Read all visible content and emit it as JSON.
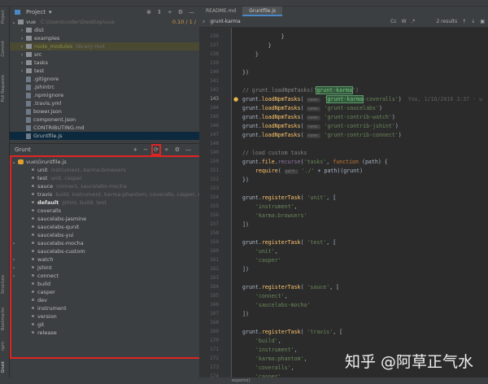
{
  "project": {
    "title": "Project",
    "root": "vue",
    "root_path": "C:\\Users\\coder\\Desktop\\vue",
    "version": "0.10 / 1 /",
    "items": [
      {
        "label": "dist",
        "type": "folder"
      },
      {
        "label": "examples",
        "type": "folder"
      },
      {
        "label": "node_modules",
        "hint": "library root",
        "type": "folder",
        "ignored": true
      },
      {
        "label": "src",
        "type": "folder"
      },
      {
        "label": "tasks",
        "type": "folder"
      },
      {
        "label": "test",
        "type": "folder"
      },
      {
        "label": ".gitignore",
        "type": "file"
      },
      {
        "label": ".jshintrc",
        "type": "file"
      },
      {
        "label": ".npmignore",
        "type": "file"
      },
      {
        "label": ".travis.yml",
        "type": "file"
      },
      {
        "label": "bower.json",
        "type": "file"
      },
      {
        "label": "component.json",
        "type": "file"
      },
      {
        "label": "CONTRIBUTING.md",
        "type": "file"
      },
      {
        "label": "Gruntfile.js",
        "type": "file",
        "selected": true
      }
    ]
  },
  "grunt": {
    "title": "Grunt",
    "root": "vue\\Gruntfile.js",
    "tasks": [
      {
        "label": "unit",
        "hint": "instrument, karma:browsers"
      },
      {
        "label": "test",
        "hint": "unit, casper"
      },
      {
        "label": "sauce",
        "hint": "connect, saucelabs-mocha"
      },
      {
        "label": "travis",
        "hint": "build, instrument, karma:phantom, coveralls, casper, sauce"
      },
      {
        "label": "default",
        "hint": "jshint, build, test",
        "bold": true
      },
      {
        "label": "coveralls"
      },
      {
        "label": "saucelabs-jasmine"
      },
      {
        "label": "saucelabs-qunit"
      },
      {
        "label": "saucelabs-yui"
      },
      {
        "label": "saucelabs-mocha",
        "expandable": true
      },
      {
        "label": "saucelabs-custom"
      },
      {
        "label": "watch",
        "expandable": true
      },
      {
        "label": "jshint",
        "expandable": true
      },
      {
        "label": "connect",
        "expandable": true
      },
      {
        "label": "build"
      },
      {
        "label": "casper"
      },
      {
        "label": "dev"
      },
      {
        "label": "instrument"
      },
      {
        "label": "version"
      },
      {
        "label": "git"
      },
      {
        "label": "release"
      }
    ]
  },
  "toolstrip": [
    "Project",
    "Commit",
    "Pull Requests",
    "Structure",
    "Bookmarks",
    "npm",
    "Grunt"
  ],
  "editor": {
    "tabs": [
      "README.md",
      "Gruntfile.js"
    ],
    "active_tab": 1,
    "search": {
      "query": "grunt-karma",
      "options": [
        "Cc",
        "W",
        ".*"
      ],
      "results": "2 results"
    },
    "first_line": 136,
    "current_line": 143,
    "blame": "You, 1/16/2016 3:37 · u"
  },
  "status": {
    "breadcrumb": "exports()"
  },
  "watermark": "知乎 @阿草正气水"
}
